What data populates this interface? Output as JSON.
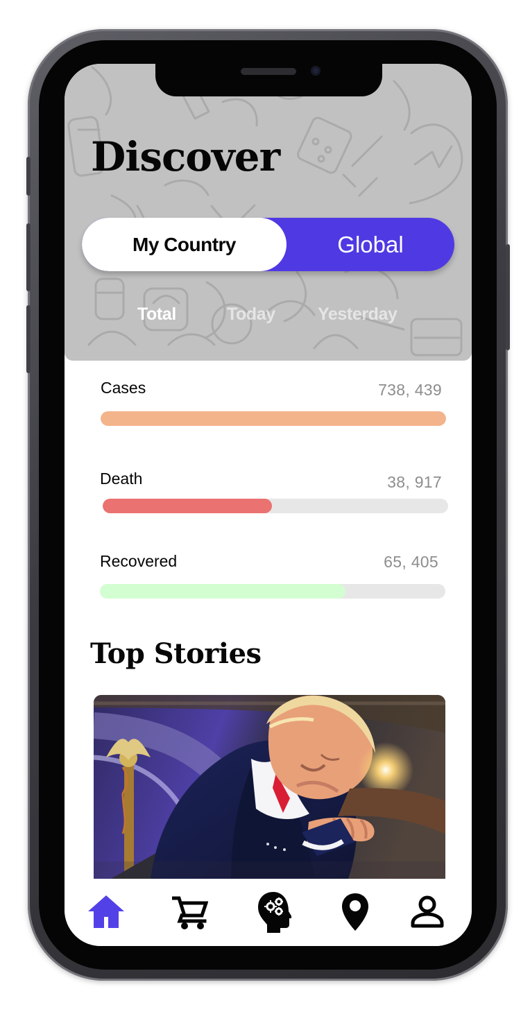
{
  "discover": {
    "title": "Discover"
  },
  "segmented": {
    "my_country": "My Country",
    "global": "Global"
  },
  "period_tabs": {
    "total": "Total",
    "today": "Today",
    "yesterday": "Yesterday"
  },
  "stats": [
    {
      "label": "Cases",
      "value": "738, 439",
      "progress": 1.0,
      "color": "#f4b48b"
    },
    {
      "label": "Death",
      "value": "38, 917",
      "progress": 0.49,
      "color": "#ea7270"
    },
    {
      "label": "Recovered",
      "value": "65, 405",
      "progress": 0.71,
      "color": "#d3fed1"
    }
  ],
  "top_stories": {
    "title": "Top Stories"
  },
  "bottom_nav": {
    "active_color": "#5341e8",
    "items": [
      "home-icon",
      "cart-icon",
      "mental-health-icon",
      "location-icon",
      "profile-icon"
    ]
  },
  "colors": {
    "accent": "#4f39e3",
    "header_background": "#c1c1c1",
    "text_primary": "#060606",
    "text_secondary": "#8d8d8d"
  }
}
